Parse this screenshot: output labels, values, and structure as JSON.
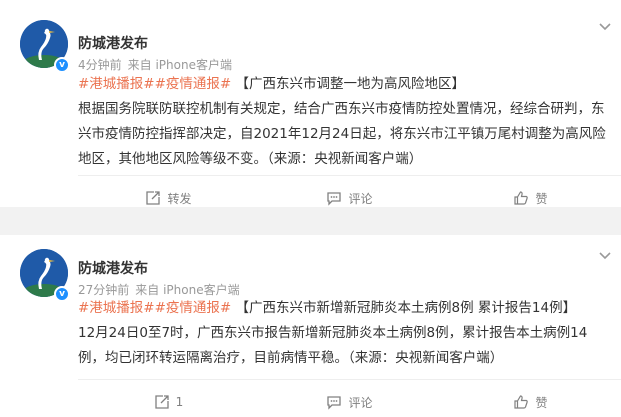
{
  "posts": [
    {
      "author": "防城港发布",
      "time": "4分钟前",
      "source": "来自 iPhone客户端",
      "tag1": "#港城播报#",
      "tag2": "#疫情通报#",
      "headline": "【广西东兴市调整一地为高风险地区】",
      "body": "根据国务院联防联控机制有关规定，结合广西东兴市疫情防控处置情况，经综合研判，东兴市疫情防控指挥部决定，自2021年12月24日起，将东兴市江平镇万尾村调整为高风险地区，其他地区风险等级不变。（来源：央视新闻客户端）",
      "repost": "转发",
      "comment": "评论",
      "like": "赞"
    },
    {
      "author": "防城港发布",
      "time": "27分钟前",
      "source": "来自 iPhone客户端",
      "tag1": "#港城播报#",
      "tag2": "#疫情通报#",
      "headline": "【广西东兴市新增新冠肺炎本土病例8例 累计报告14例】",
      "body": "12月24日0至7时，广西东兴市报告新增新冠肺炎本土病例8例，累计报告本土病例14例，均已闭环转运隔离治疗，目前病情平稳。（来源：央视新闻客户端）",
      "repost": "1",
      "comment": "评论",
      "like": "赞"
    }
  ],
  "colors": {
    "tag": "#eb7350",
    "text": "#333333",
    "meta": "#999999",
    "verified": "#1e90ff",
    "separator": "#f2f2f2"
  },
  "icons": [
    "avatar-crane-logo",
    "verified-badge-icon",
    "chevron-down-icon",
    "repost-icon",
    "comment-icon",
    "like-icon"
  ]
}
